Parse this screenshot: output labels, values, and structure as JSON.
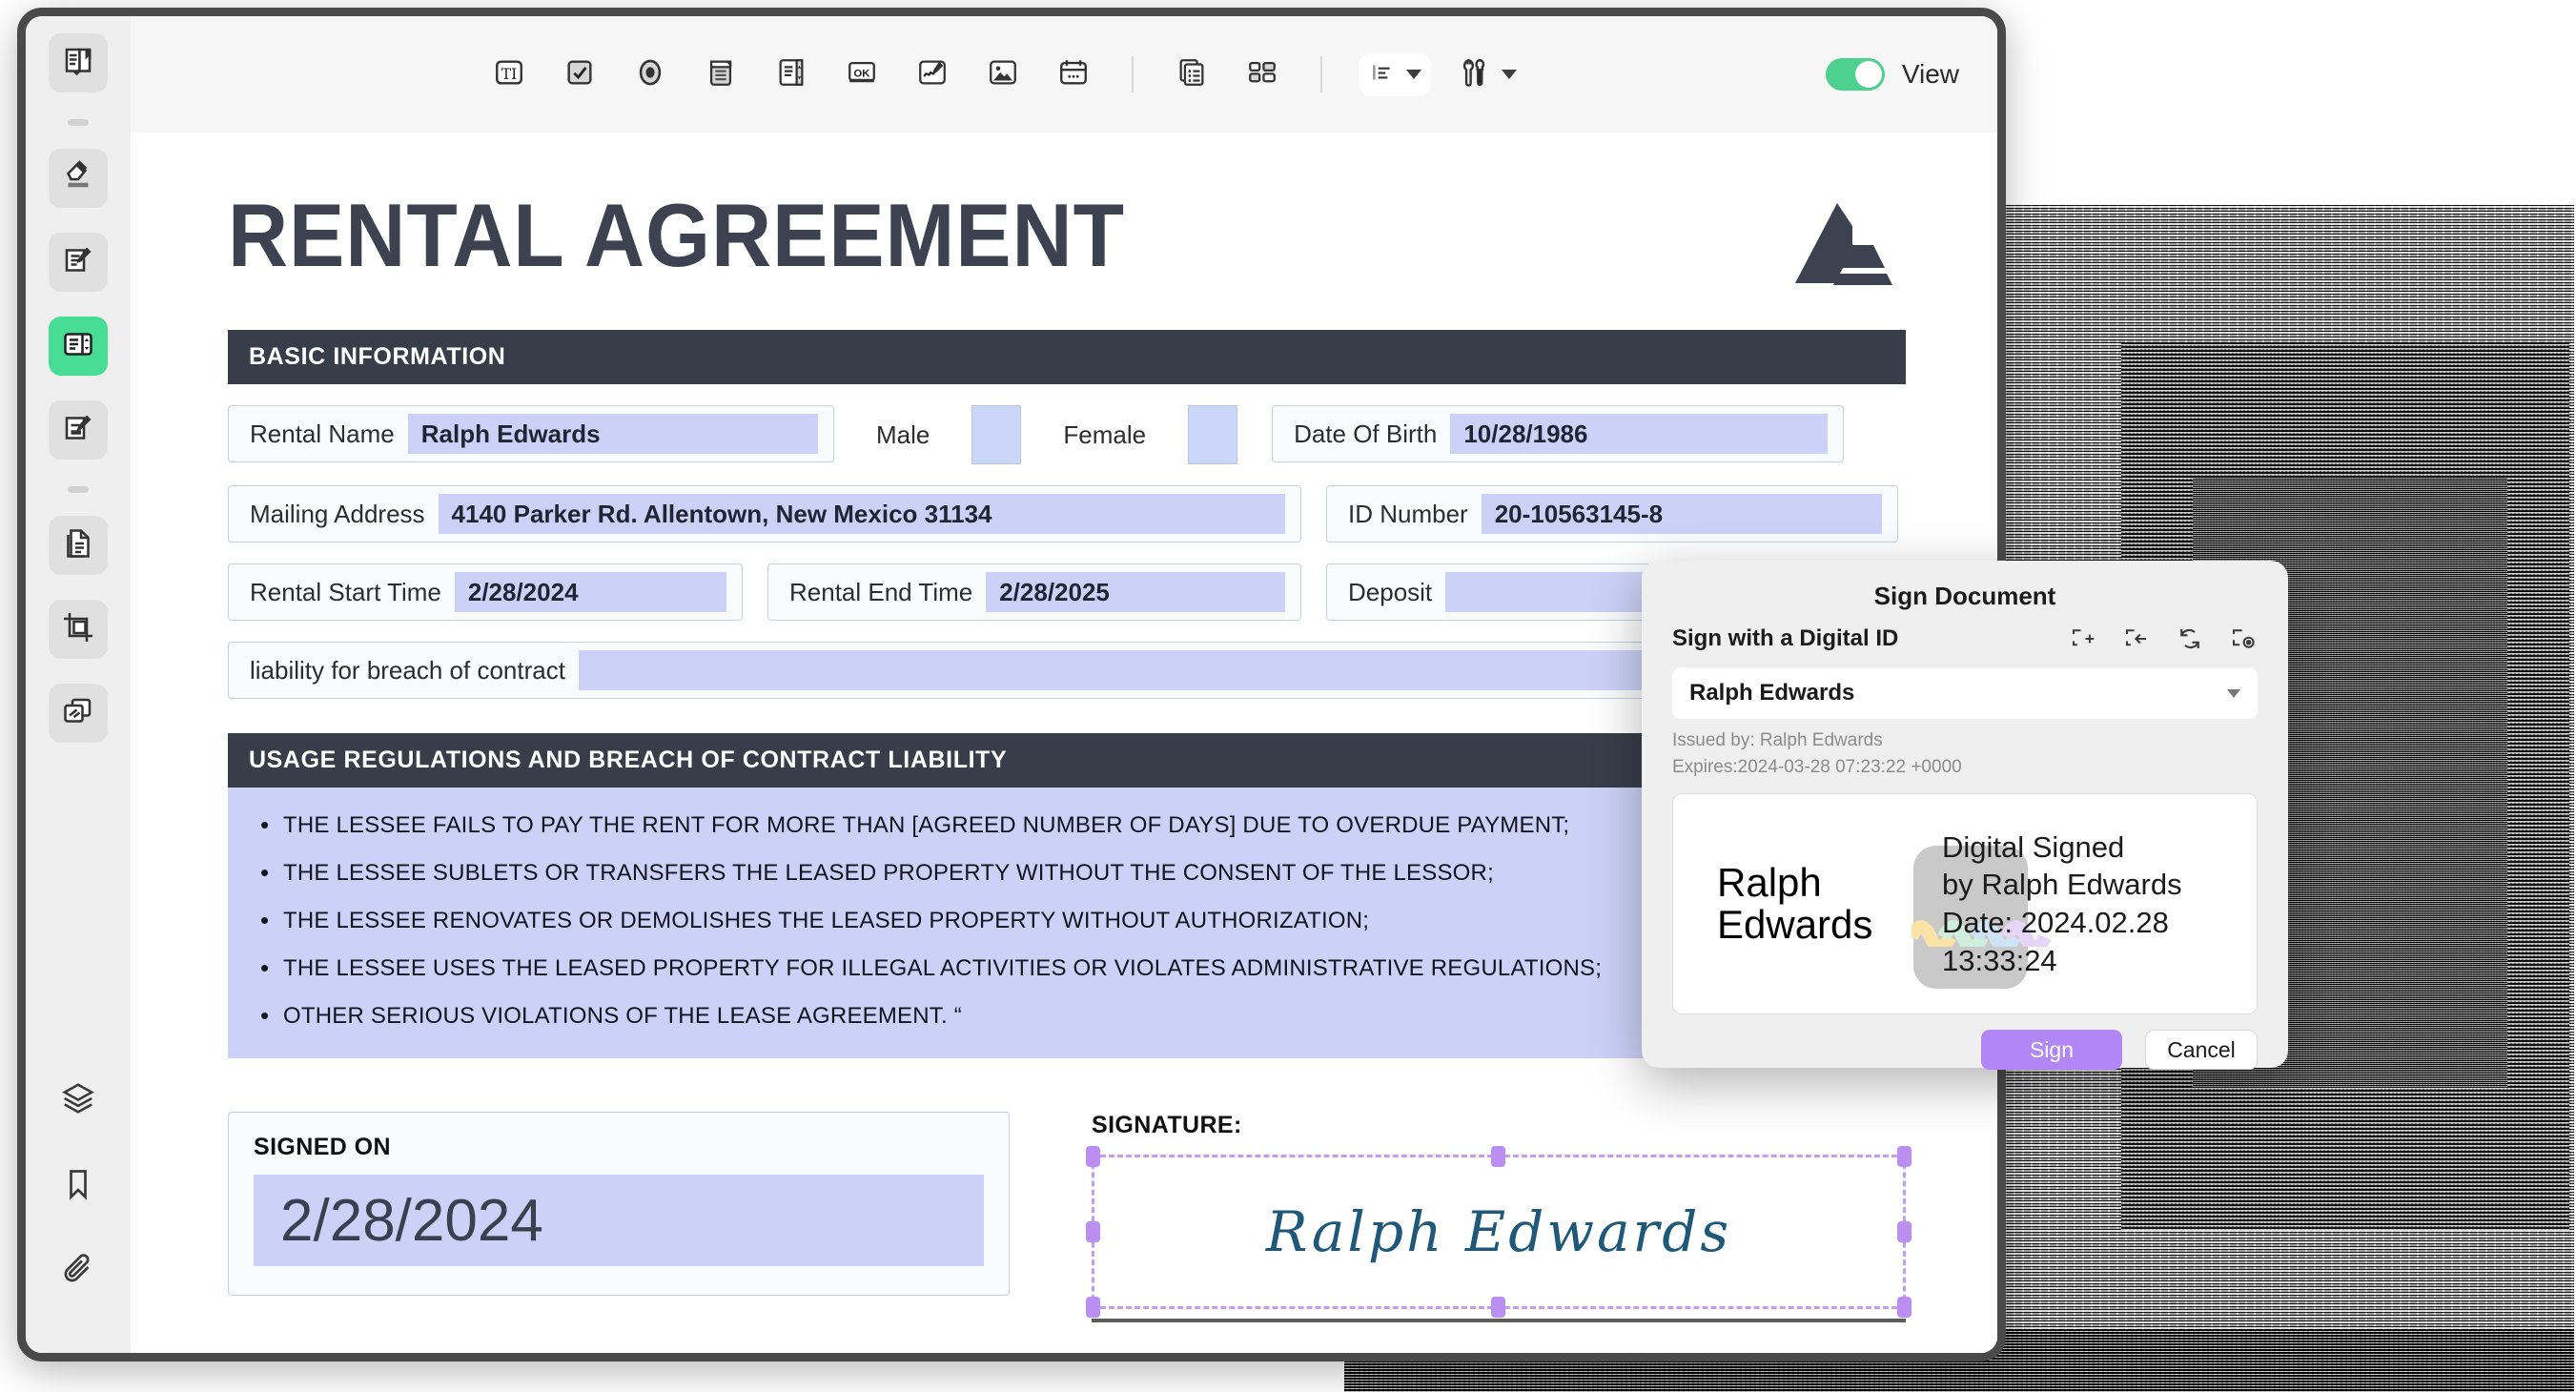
{
  "window": {
    "toolbar": {
      "tools": [
        {
          "name": "text-field-tool",
          "glyph": "TI"
        },
        {
          "name": "checkbox-tool",
          "glyph": "check"
        },
        {
          "name": "radio-button-tool",
          "glyph": "radio"
        },
        {
          "name": "dropdown-tool",
          "glyph": "dropdown"
        },
        {
          "name": "list-box-tool",
          "glyph": "listbox"
        },
        {
          "name": "push-button-tool",
          "glyph": "OK"
        },
        {
          "name": "signature-tool",
          "glyph": "signature"
        },
        {
          "name": "image-field-tool",
          "glyph": "image"
        },
        {
          "name": "date-field-tool",
          "glyph": "calendar"
        },
        {
          "name": "form-list-tool",
          "glyph": "formlist"
        },
        {
          "name": "grid-layout-tool",
          "glyph": "grid"
        },
        {
          "name": "align-tool",
          "glyph": "align"
        },
        {
          "name": "form-settings-tool",
          "glyph": "tools"
        }
      ],
      "view_toggle_label": "View",
      "view_toggle_on": true,
      "accent_green": "#4ed18e"
    },
    "sidebar": {
      "items": [
        {
          "name": "sidebar-item-read-mode",
          "icon": "book-reader-icon",
          "active": false
        },
        {
          "name": "sidebar-item-highlight",
          "icon": "highlighter-icon",
          "active": false
        },
        {
          "name": "sidebar-item-annotate",
          "icon": "note-edit-icon",
          "active": false
        },
        {
          "name": "sidebar-item-form",
          "icon": "form-fields-icon",
          "active": true
        },
        {
          "name": "sidebar-item-fill-sign",
          "icon": "fill-sign-icon",
          "active": false
        },
        {
          "name": "sidebar-item-organize-pages",
          "icon": "page-copy-icon",
          "active": false
        },
        {
          "name": "sidebar-item-crop",
          "icon": "crop-icon",
          "active": false
        },
        {
          "name": "sidebar-item-compare",
          "icon": "compare-pages-icon",
          "active": false
        }
      ],
      "bottom_items": [
        {
          "name": "sidebar-item-layers",
          "icon": "layers-icon"
        },
        {
          "name": "sidebar-item-bookmarks",
          "icon": "bookmark-icon"
        },
        {
          "name": "sidebar-item-attachments",
          "icon": "paperclip-icon"
        }
      ]
    }
  },
  "document": {
    "title": "RENTAL AGREEMENT",
    "logo_name": "company-logo",
    "sections": [
      {
        "heading": "BASIC INFORMATION"
      },
      {
        "heading": "USAGE REGULATIONS AND BREACH OF CONTRACT LIABILITY"
      }
    ],
    "fields": {
      "rental_name": {
        "label": "Rental Name",
        "value": "Ralph Edwards"
      },
      "male": {
        "label": "Male",
        "value": ""
      },
      "female": {
        "label": "Female",
        "value": ""
      },
      "date_of_birth": {
        "label": "Date Of Birth",
        "value": "10/28/1986"
      },
      "mailing_address": {
        "label": "Mailing Address",
        "value": "4140 Parker Rd. Allentown, New Mexico 31134"
      },
      "id_number": {
        "label": "ID Number",
        "value": "20-10563145-8"
      },
      "rental_start_time": {
        "label": "Rental Start Time",
        "value": "2/28/2024"
      },
      "rental_end_time": {
        "label": "Rental End Time",
        "value": "2/28/2025"
      },
      "deposit": {
        "label": "Deposit",
        "value": ""
      },
      "liability": {
        "label": "liability for breach of contract",
        "value": ""
      }
    },
    "regulations": [
      "THE LESSEE FAILS TO PAY THE RENT FOR MORE THAN [AGREED NUMBER OF DAYS] DUE TO OVERDUE PAYMENT;",
      "THE LESSEE SUBLETS OR TRANSFERS THE LEASED PROPERTY WITHOUT THE CONSENT OF THE LESSOR;",
      "THE LESSEE RENOVATES OR DEMOLISHES THE LEASED PROPERTY WITHOUT AUTHORIZATION;",
      "THE LESSEE USES THE LEASED PROPERTY FOR ILLEGAL ACTIVITIES OR VIOLATES ADMINISTRATIVE REGULATIONS;",
      "OTHER SERIOUS VIOLATIONS OF THE LEASE AGREEMENT. “"
    ],
    "signed_on": {
      "label": "SIGNED ON",
      "value": "2/28/2024"
    },
    "signature": {
      "label": "SIGNATURE:",
      "value": "Ralph Edwards",
      "ink_color": "#1f5878",
      "selection_color": "#bb8ef2"
    }
  },
  "sign_dialog": {
    "title": "Sign Document",
    "subtitle": "Sign with a Digital ID",
    "selected_id": "Ralph Edwards",
    "issued_by": "Issued by: Ralph Edwards",
    "expires": "Expires:2024-03-28 07:23:22 +0000",
    "preview_name": "Ralph Edwards",
    "preview_line1": "Digital Signed",
    "preview_line2": "by Ralph Edwards",
    "preview_line3": "Date: 2024.02.28",
    "preview_line4": "13:33:24",
    "icons": [
      {
        "name": "new-digital-id-icon"
      },
      {
        "name": "import-digital-id-icon"
      },
      {
        "name": "refresh-icon"
      },
      {
        "name": "preview-icon"
      }
    ],
    "sign_label": "Sign",
    "cancel_label": "Cancel",
    "sign_button_color": "#b287f5"
  }
}
